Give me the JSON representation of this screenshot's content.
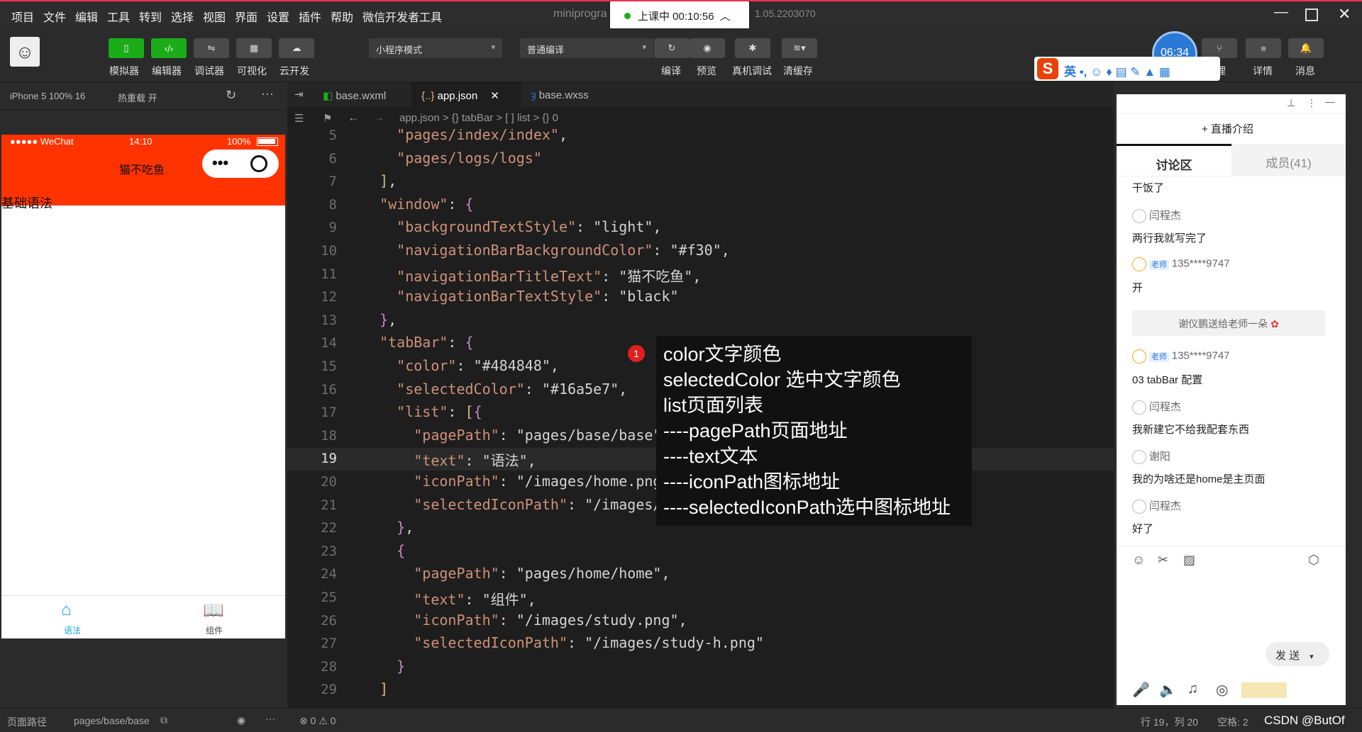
{
  "menu": [
    "项目",
    "文件",
    "编辑",
    "工具",
    "转到",
    "选择",
    "视图",
    "界面",
    "设置",
    "插件",
    "帮助",
    "微信开发者工具"
  ],
  "window_title": "miniprogra",
  "version": "1.05.2203070",
  "live": {
    "label": "上课中 00:10:56"
  },
  "toolbar": {
    "simulator": "模拟器",
    "editor": "编辑器",
    "debugger": "调试器",
    "visual": "可视化",
    "cloud": "云开发",
    "mode_select": "小程序模式",
    "compile_select": "普通编译",
    "compile": "编译",
    "preview": "预览",
    "device_debug": "真机调试",
    "clear_cache": "清缓存",
    "manage": "管理",
    "details": "详情",
    "messages": "消息"
  },
  "clock": "06:34",
  "sim": {
    "device": "iPhone 5 100% 16",
    "hot_reload": "热重载 开"
  },
  "phone": {
    "carrier": "●●●●● WeChat",
    "time": "14:10",
    "battery": "100%",
    "nav_title": "猫不吃鱼",
    "body_text": "基础语法",
    "tab1": "语法",
    "tab2": "组件"
  },
  "editor": {
    "tabs": [
      "base.wxml",
      "app.json",
      "base.wxss"
    ],
    "breadcrumb": "app.json > {} tabBar > [ ] list > {} 0",
    "tip_badge": "1",
    "tip_lines": [
      "color文字颜色",
      "selectedColor 选中文字颜色",
      "list页面列表",
      "----pagePath页面地址",
      "----text文本",
      "----iconPath图标地址",
      "----selectedIconPath选中图标地址"
    ]
  },
  "code_lines": [
    {
      "n": "5",
      "t": "    \"pages/index/index\","
    },
    {
      "n": "6",
      "t": "    \"pages/logs/logs\""
    },
    {
      "n": "7",
      "t": "  ],"
    },
    {
      "n": "8",
      "t": "  \"window\": {"
    },
    {
      "n": "9",
      "t": "    \"backgroundTextStyle\": \"light\","
    },
    {
      "n": "10",
      "t": "    \"navigationBarBackgroundColor\": \"#f30\","
    },
    {
      "n": "11",
      "t": "    \"navigationBarTitleText\": \"猫不吃鱼\","
    },
    {
      "n": "12",
      "t": "    \"navigationBarTextStyle\": \"black\""
    },
    {
      "n": "13",
      "t": "  },"
    },
    {
      "n": "14",
      "t": "  \"tabBar\": {"
    },
    {
      "n": "15",
      "t": "    \"color\": \"#484848\","
    },
    {
      "n": "16",
      "t": "    \"selectedColor\": \"#16a5e7\","
    },
    {
      "n": "17",
      "t": "    \"list\": [{"
    },
    {
      "n": "18",
      "t": "      \"pagePath\": \"pages/base/base\","
    },
    {
      "n": "19",
      "t": "      \"text\": \"语法\","
    },
    {
      "n": "20",
      "t": "      \"iconPath\": \"/images/home.png\","
    },
    {
      "n": "21",
      "t": "      \"selectedIconPath\": \"/images/home-h.png\""
    },
    {
      "n": "22",
      "t": "    },"
    },
    {
      "n": "23",
      "t": "    {"
    },
    {
      "n": "24",
      "t": "      \"pagePath\": \"pages/home/home\","
    },
    {
      "n": "25",
      "t": "      \"text\": \"组件\","
    },
    {
      "n": "26",
      "t": "      \"iconPath\": \"/images/study.png\","
    },
    {
      "n": "27",
      "t": "      \"selectedIconPath\": \"/images/study-h.png\""
    },
    {
      "n": "28",
      "t": "    }"
    },
    {
      "n": "29",
      "t": "  ]"
    }
  ],
  "chat": {
    "intro": "+ 直播介绍",
    "tab_discuss": "讨论区",
    "tab_members": "成员(41)",
    "messages": [
      {
        "name": "",
        "text": "干饭了"
      },
      {
        "name": "闫程杰",
        "text": "两行我就写完了"
      },
      {
        "name": "135****9747",
        "badge": "老师",
        "text": "开"
      },
      {
        "system": "谢仪鹏送给老师一朵"
      },
      {
        "name": "135****9747",
        "badge": "老师",
        "text": "03 tabBar 配置"
      },
      {
        "name": "闫程杰",
        "text": "我新建它不给我配套东西"
      },
      {
        "name": "谢阳",
        "text": "我的为啥还是home是主页面"
      },
      {
        "name": "闫程杰",
        "text": "好了"
      }
    ],
    "send": "发 送"
  },
  "statusbar": {
    "path_label": "页面路径",
    "path": "pages/base/base",
    "errors": "⊗ 0 ⚠ 0",
    "cursor": "行 19，列 20",
    "spaces": "空格: 2",
    "watermark": "CSDN @ButOf"
  }
}
